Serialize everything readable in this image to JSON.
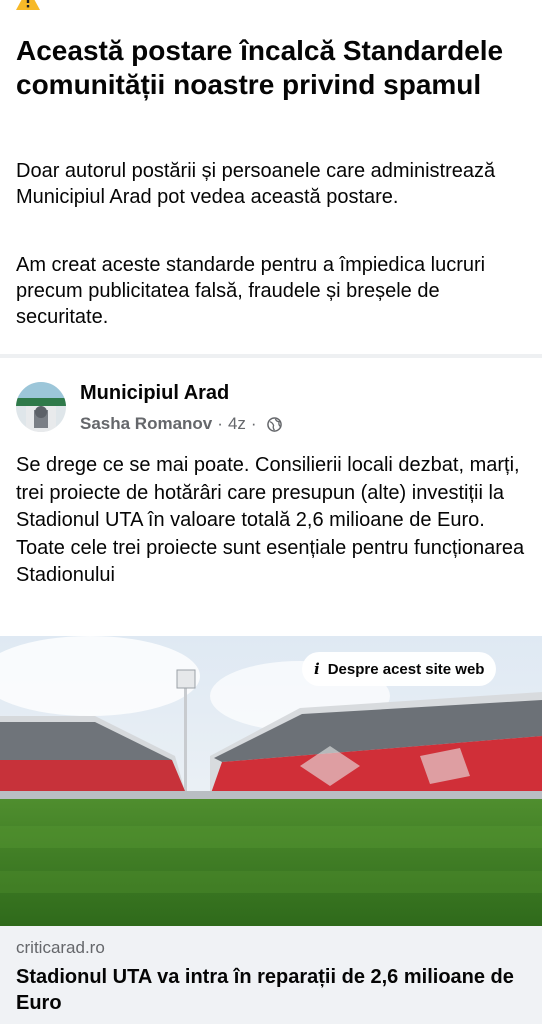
{
  "notice": {
    "icon": "warning-icon",
    "title": "Această postare încalcă Standardele comunității noastre privind spamul",
    "paragraph1": "Doar autorul postării și persoanele care administrează Municipiul Arad pot vedea această postare.",
    "paragraph2": "Am creat aceste standarde pentru a împiedica lucruri precum publicitatea falsă, fraudele și breșele de securitate."
  },
  "post": {
    "page_name": "Municipiul Arad",
    "author": "Sasha Romanov",
    "time": "4z",
    "dot": "·",
    "audience_icon": "globe-icon",
    "text": "Se drege ce se mai poate. Consilierii locali dezbat, marți, trei proiecte de hotărâri care presupun (alte) investiții la Stadionul UTA în valoare totală 2,6 milioane de Euro. Toate cele trei proiecte sunt esențiale pentru funcționarea Stadionului"
  },
  "link": {
    "about_site_icon": "i",
    "about_site_label": "Despre acest site web",
    "domain": "criticarad.ro",
    "title": "Stadionul UTA va intra în reparații de 2,6 milioane de Euro"
  }
}
